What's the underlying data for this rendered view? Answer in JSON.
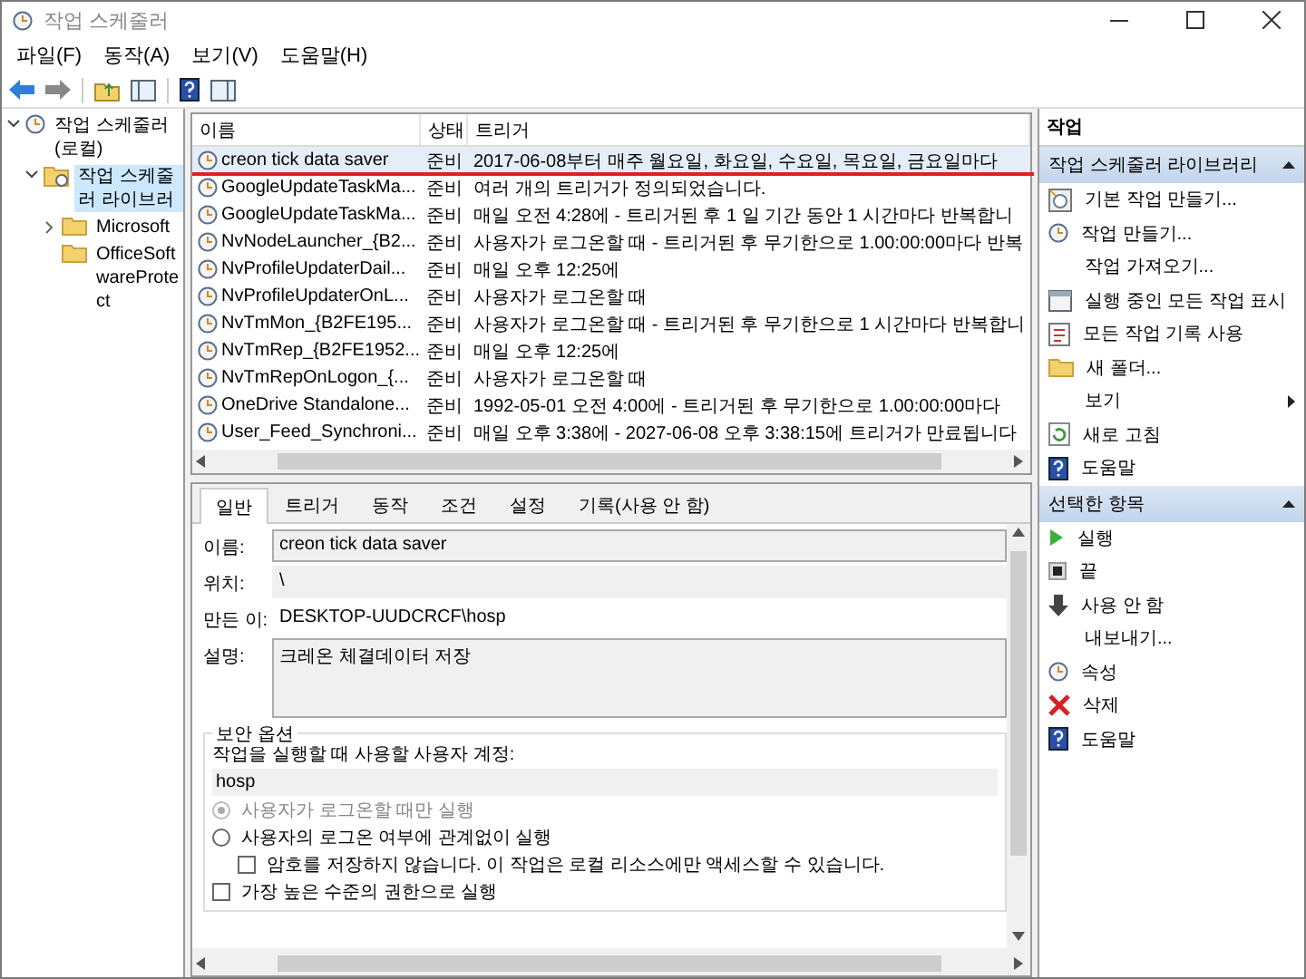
{
  "window": {
    "title": "작업 스케줄러"
  },
  "menu": [
    "파일(F)",
    "동작(A)",
    "보기(V)",
    "도움말(H)"
  ],
  "tree": [
    {
      "label": "작업 스케줄러 (로컬)",
      "expanded": true,
      "selected": false,
      "children": [
        {
          "label": "작업 스케줄러 라이브러",
          "expanded": true,
          "selected": true,
          "children": [
            {
              "label": "Microsoft",
              "expanded": false,
              "selected": false
            },
            {
              "label": "OfficeSoftwareProtect",
              "selected": false
            }
          ]
        }
      ]
    }
  ],
  "tasks": {
    "columns": [
      "이름",
      "상태",
      "트리거"
    ],
    "rows": [
      {
        "name": "creon tick data saver",
        "status": "준비",
        "trigger": "2017-06-08부터 매주 월요일, 화요일, 수요일, 목요일, 금요일마다",
        "selected": true,
        "underlined": true
      },
      {
        "name": "GoogleUpdateTaskMa...",
        "status": "준비",
        "trigger": "여러 개의 트리거가 정의되었습니다.",
        "selected": false,
        "underlined": false
      },
      {
        "name": "GoogleUpdateTaskMa...",
        "status": "준비",
        "trigger": "매일 오전 4:28에 - 트리거된 후 1 일 기간 동안 1 시간마다 반복합니",
        "selected": false,
        "underlined": false
      },
      {
        "name": "NvNodeLauncher_{B2...",
        "status": "준비",
        "trigger": "사용자가 로그온할 때 - 트리거된 후 무기한으로 1.00:00:00마다 반복",
        "selected": false,
        "underlined": false
      },
      {
        "name": "NvProfileUpdaterDail...",
        "status": "준비",
        "trigger": "매일 오후 12:25에",
        "selected": false,
        "underlined": false
      },
      {
        "name": "NvProfileUpdaterOnL...",
        "status": "준비",
        "trigger": "사용자가 로그온할 때",
        "selected": false,
        "underlined": false
      },
      {
        "name": "NvTmMon_{B2FE195...",
        "status": "준비",
        "trigger": "사용자가 로그온할 때 - 트리거된 후 무기한으로 1 시간마다 반복합니",
        "selected": false,
        "underlined": false
      },
      {
        "name": "NvTmRep_{B2FE1952...",
        "status": "준비",
        "trigger": "매일 오후 12:25에",
        "selected": false,
        "underlined": false
      },
      {
        "name": "NvTmRepOnLogon_{...",
        "status": "준비",
        "trigger": "사용자가 로그온할 때",
        "selected": false,
        "underlined": false
      },
      {
        "name": "OneDrive Standalone...",
        "status": "준비",
        "trigger": "1992-05-01 오전 4:00에 - 트리거된 후 무기한으로 1.00:00:00마다",
        "selected": false,
        "underlined": false
      },
      {
        "name": "User_Feed_Synchroni...",
        "status": "준비",
        "trigger": "매일 오후 3:38에 - 2027-06-08 오후 3:38:15에 트리거가 만료됩니다",
        "selected": false,
        "underlined": false
      }
    ]
  },
  "detail": {
    "tabs": [
      {
        "label": "일반",
        "selected": true
      },
      {
        "label": "트리거",
        "selected": false
      },
      {
        "label": "동작",
        "selected": false
      },
      {
        "label": "조건",
        "selected": false
      },
      {
        "label": "설정",
        "selected": false
      },
      {
        "label": "기록(사용 안 함)",
        "selected": false
      }
    ],
    "name_label": "이름:",
    "name": "creon tick data saver",
    "location_label": "위치:",
    "location": "\\",
    "author_label": "만든 이:",
    "author": "DESKTOP-UUDCRCF\\hosp",
    "description_label": "설명:",
    "description": "크레온 체결데이터 저장",
    "security": {
      "title": "보안 옵션",
      "account_label": "작업을 실행할 때 사용할 사용자 계정:",
      "account": "hosp",
      "radios": [
        {
          "label": "사용자가 로그온할 때만 실행",
          "selected": true,
          "disabled": true
        },
        {
          "label": "사용자의 로그온 여부에 관계없이 실행",
          "selected": false,
          "disabled": false,
          "children": [
            {
              "label": "암호를 저장하지 않습니다. 이 작업은 로컬 리소스에만 액세스할 수 있습니다.",
              "checked": false
            }
          ]
        }
      ],
      "checkboxes": [
        {
          "label": "가장 높은 수준의 권한으로 실행",
          "checked": false
        }
      ]
    }
  },
  "actions": [
    {
      "title": "작업",
      "sections": [
        {
          "title": "작업 스케줄러 라이브러리",
          "expanded": true,
          "items": [
            {
              "label": "기본 작업 만들기...",
              "kind": "basic-task"
            },
            {
              "label": "작업 만들기...",
              "kind": "task"
            },
            {
              "label": "작업 가져오기...",
              "kind": "none"
            },
            {
              "label": "실행 중인 모든 작업 표시",
              "kind": "running"
            },
            {
              "label": "모든 작업 기록 사용",
              "kind": "history"
            },
            {
              "label": "새 폴더...",
              "kind": "folder"
            },
            {
              "label": "보기",
              "kind": "submenu"
            },
            {
              "label": "새로 고침",
              "kind": "refresh"
            },
            {
              "label": "도움말",
              "kind": "help"
            }
          ]
        },
        {
          "title": "선택한 항목",
          "expanded": true,
          "items": [
            {
              "label": "실행",
              "kind": "run"
            },
            {
              "label": "끝",
              "kind": "end"
            },
            {
              "label": "사용 안 함",
              "kind": "disable"
            },
            {
              "label": "내보내기...",
              "kind": "none"
            },
            {
              "label": "속성",
              "kind": "properties"
            },
            {
              "label": "삭제",
              "kind": "delete"
            },
            {
              "label": "도움말",
              "kind": "help"
            }
          ]
        }
      ]
    }
  ]
}
